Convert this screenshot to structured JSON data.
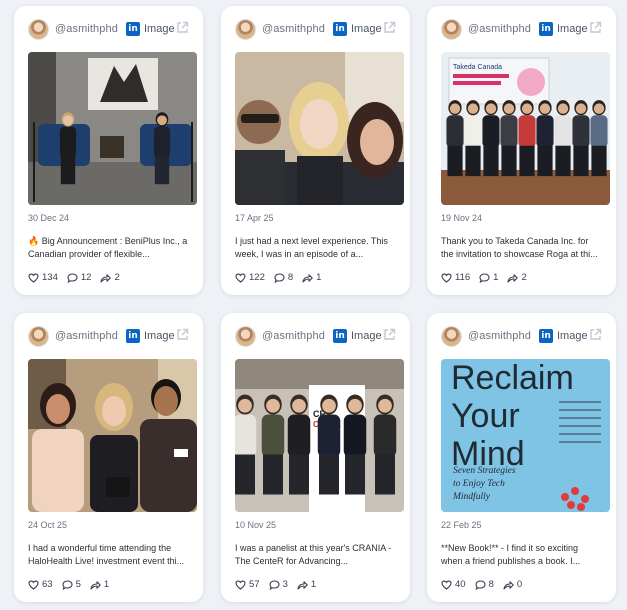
{
  "posts": [
    {
      "handle": "@asmithphd",
      "source": "Image",
      "date": "30 Dec 24",
      "excerpt": [
        "🔥 Big Announcement : BeniPlus Inc., a",
        "Canadian provider of flexible..."
      ],
      "likes": "134",
      "comments": "12",
      "shares": "2",
      "photo": "interview"
    },
    {
      "handle": "@asmithphd",
      "source": "Image",
      "date": "17 Apr 25",
      "excerpt": [
        "I just had a next level experience. This",
        "week, I was in an episode of a..."
      ],
      "likes": "122",
      "comments": "8",
      "shares": "1",
      "photo": "selfie"
    },
    {
      "handle": "@asmithphd",
      "source": "Image",
      "date": "19 Nov 24",
      "excerpt": [
        "Thank you to Takeda Canada Inc. for",
        "the invitation to showcase Roga at thi..."
      ],
      "likes": "116",
      "comments": "1",
      "shares": "2",
      "photo": "group",
      "photo_text": "Takeda Canada"
    },
    {
      "handle": "@asmithphd",
      "source": "Image",
      "date": "24 Oct 25",
      "excerpt": [
        "I had a wonderful time attending the",
        "HaloHealth Live! investment event thi..."
      ],
      "likes": "63",
      "comments": "5",
      "shares": "1",
      "photo": "trio"
    },
    {
      "handle": "@asmithphd",
      "source": "Image",
      "date": "10 Nov 25",
      "excerpt": [
        "I was a panelist at this year's CRANIA -",
        "The CenteR for Advancing..."
      ],
      "likes": "57",
      "comments": "3",
      "shares": "1",
      "photo": "panel",
      "photo_text": [
        "CR",
        "CONFE"
      ]
    },
    {
      "handle": "@asmithphd",
      "source": "Image",
      "date": "22 Feb 25",
      "excerpt": [
        "**New Book!** - I find it so exciting",
        "when a friend publishes a book. I..."
      ],
      "likes": "40",
      "comments": "8",
      "shares": "0",
      "photo": "book",
      "book": {
        "title_lines": [
          "Reclaim",
          "Your",
          "Mind"
        ],
        "subtitle_lines": [
          "Seven Strategies",
          "to Enjoy Tech",
          "Mindfully"
        ]
      }
    }
  ],
  "icons": {
    "source_icon": "linkedin-icon",
    "open_icon": "external-link-icon",
    "like_icon": "heart-icon",
    "comment_icon": "comment-icon",
    "share_icon": "share-icon"
  },
  "colors": {
    "background": "#eef1f5",
    "card": "#ffffff",
    "linkedin_blue": "#0a66c2",
    "book_cover": "#7fc3e5"
  }
}
